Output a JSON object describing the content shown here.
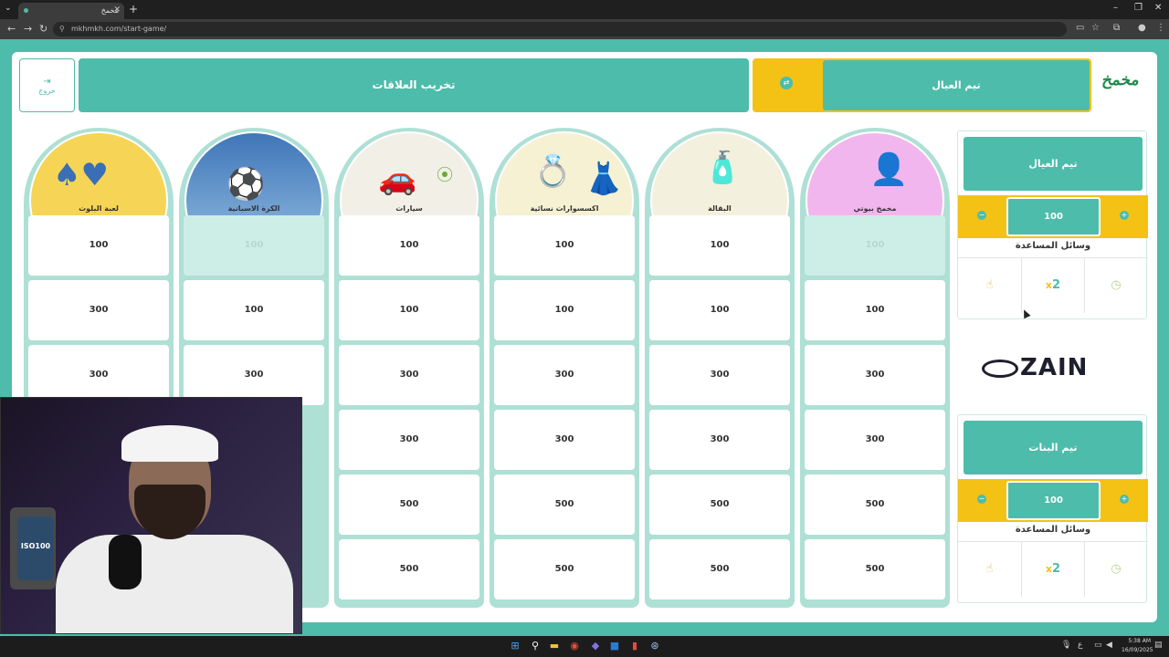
{
  "browser": {
    "tab_title": "مخمخ",
    "url": "mkhmkh.com/start-game/",
    "new_tab": "+"
  },
  "header": {
    "exit_label": "خروج",
    "game_title": "تخريب العلاقات",
    "current_turn_team": "تيم العيال",
    "logo_text": "مخمخ"
  },
  "board": {
    "categories": [
      {
        "label": "لعبة البلوت",
        "scores": [
          "100",
          "300",
          "300",
          "",
          "",
          ""
        ]
      },
      {
        "label": "الكرة الاسبانية",
        "scores": [
          "100",
          "100",
          "300",
          "",
          "",
          ""
        ]
      },
      {
        "label": "سيارات",
        "scores": [
          "100",
          "100",
          "300",
          "300",
          "500",
          "500"
        ]
      },
      {
        "label": "اكسسوارات نسائية",
        "scores": [
          "100",
          "100",
          "300",
          "300",
          "500",
          "500"
        ]
      },
      {
        "label": "البقالة",
        "scores": [
          "100",
          "100",
          "300",
          "300",
          "500",
          "500"
        ]
      },
      {
        "label": "مخمخ بيوتي",
        "scores": [
          "100",
          "100",
          "300",
          "300",
          "500",
          "500"
        ]
      }
    ]
  },
  "teams": [
    {
      "name": "تيم العيال",
      "score": "100",
      "aids_title": "وسائل المساعدة"
    },
    {
      "name": "تيم البنات",
      "score": "100",
      "aids_title": "وسائل المساعدة"
    }
  ],
  "aids": {
    "double": "2",
    "double_mark": "x"
  },
  "sponsor": {
    "name": "ZAIN"
  },
  "webcam": {
    "jar_label": "ISO100"
  },
  "taskbar": {
    "time": "5:38 AM",
    "date": "16/09/2025",
    "lang": "ع"
  },
  "colors": {
    "teal": "#4dbcaa",
    "yellow": "#f4c215",
    "used_cell": "#cdeee7"
  }
}
